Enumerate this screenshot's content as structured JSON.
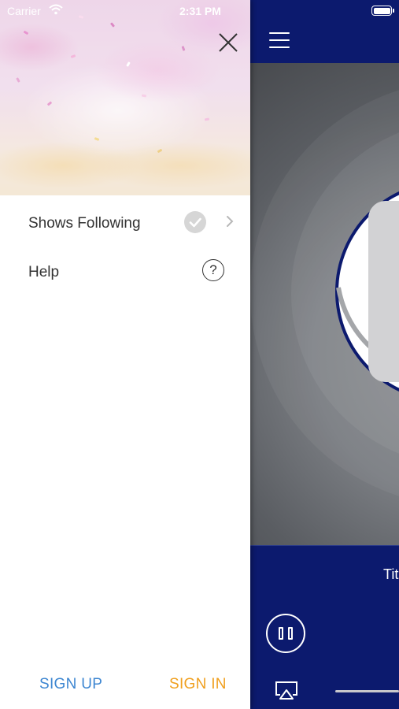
{
  "status_bar": {
    "carrier": "Carrier",
    "time": "2:31 PM"
  },
  "drawer": {
    "menu": [
      {
        "label": "Shows Following",
        "icon": "check-circle-icon",
        "trailing": "chevron-right-icon"
      },
      {
        "label": "Help",
        "icon": "help-circle-icon",
        "icon_text": "?"
      }
    ],
    "sign_up_label": "SIGN UP",
    "sign_in_label": "SIGN IN"
  },
  "player": {
    "title_partial": "Tit"
  },
  "colors": {
    "navy": "#0c1a6e",
    "sign_up": "#3d86d1",
    "sign_in": "#f0a020"
  }
}
